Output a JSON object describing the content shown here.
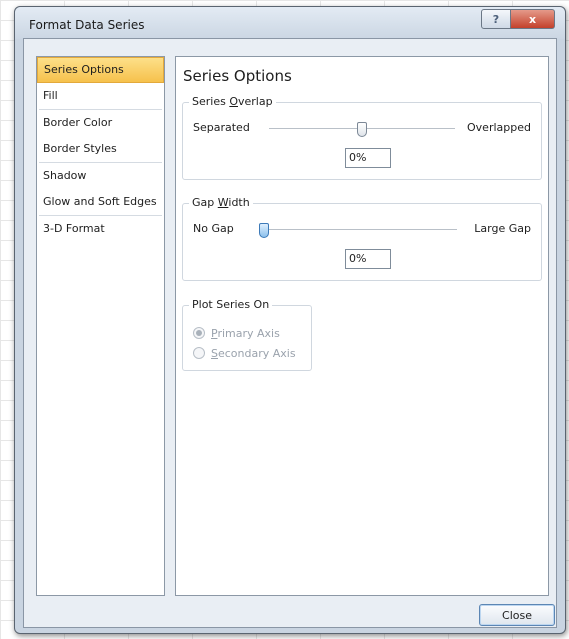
{
  "window": {
    "title": "Format Data Series",
    "help_glyph": "?",
    "close_glyph": "x"
  },
  "nav": {
    "items": [
      {
        "label": "Series Options",
        "selected": true
      },
      {
        "label": "Fill"
      },
      {
        "label": "Border Color"
      },
      {
        "label": "Border Styles"
      },
      {
        "label": "Shadow"
      },
      {
        "label": "Glow and Soft Edges"
      },
      {
        "label": "3-D Format"
      }
    ]
  },
  "panel": {
    "title": "Series Options",
    "series_overlap": {
      "label_pre": "Series ",
      "label_mnemonic": "O",
      "label_post": "verlap",
      "min_label": "Separated",
      "max_label": "Overlapped",
      "value": "0%",
      "slider_fraction": 0.5
    },
    "gap_width": {
      "label_pre": "Gap ",
      "label_mnemonic": "W",
      "label_post": "idth",
      "min_label": "No Gap",
      "max_label": "Large Gap",
      "value": "0%",
      "slider_fraction": 0.0
    },
    "plot_series_on": {
      "label": "Plot Series On",
      "primary": {
        "mnemonic": "P",
        "rest": "rimary Axis",
        "checked": true
      },
      "secondary": {
        "mnemonic": "S",
        "rest": "econdary Axis",
        "checked": false
      }
    }
  },
  "buttons": {
    "close_label": "Close"
  },
  "colors": {
    "selected_item": "#f6c14c",
    "accent_button_border": "#5c86b4"
  }
}
